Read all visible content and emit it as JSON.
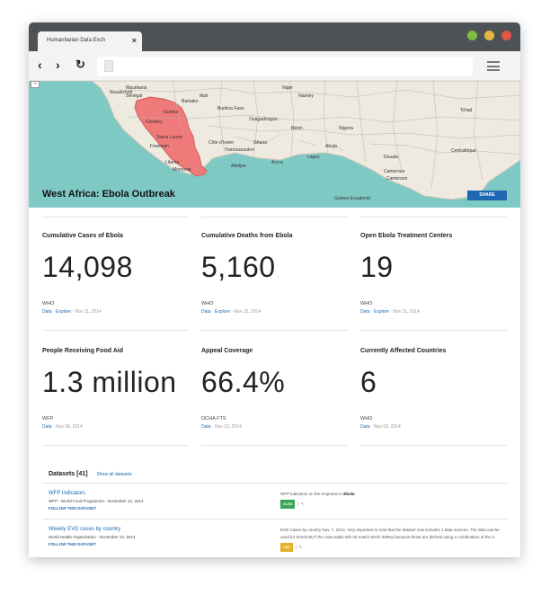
{
  "browser": {
    "tab_title": "Humanitarian Data Exch",
    "tab_close": "×",
    "back": "‹",
    "forward": "›",
    "reload": "↻"
  },
  "map": {
    "zoom_out": "−",
    "title": "West Africa: Ebola Outbreak",
    "share_label": "SHARE",
    "land_color": "#eeeae0",
    "sea_color": "#7fc9c4",
    "affected_color": "#f07a7a",
    "place_labels": [
      "Mauritania",
      "Sénégal",
      "Mali",
      "Niger",
      "Guinea",
      "Burkina Faso",
      "Bénin",
      "Nigeria",
      "Sierra Leone",
      "Côte d'Ivoire",
      "Ghana",
      "Liberia",
      "Yamoussoukro",
      "Abuja",
      "Lagos",
      "Accra",
      "Cameroun",
      "Cameroon",
      "Guinea Ecuatorial",
      "Conakry",
      "Freetown",
      "Monrovia",
      "Bamako",
      "Niamey",
      "Nouakchott",
      "Abidjan",
      "Douala",
      "Ouagadougou",
      "Tchad",
      "Centrafrique"
    ]
  },
  "stats": [
    {
      "title": "Cumulative Cases of Ebola",
      "value": "14,098",
      "source": "WHO",
      "links": [
        "Data",
        "Explore"
      ],
      "date": "Nov 11, 2014"
    },
    {
      "title": "Cumulative Deaths from Ebola",
      "value": "5,160",
      "source": "WHO",
      "links": [
        "Data",
        "Explore"
      ],
      "date": "Nov 12, 2014"
    },
    {
      "title": "Open Ebola Treatment Centers",
      "value": "19",
      "source": "WHO",
      "links": [
        "Data",
        "Explore"
      ],
      "date": "Nov 11, 2014"
    },
    {
      "title": "People Receiving Food Aid",
      "value": "1.3 million",
      "source": "WFP",
      "links": [
        "Data"
      ],
      "date": "Nov 08, 2014"
    },
    {
      "title": "Appeal Coverage",
      "value": "66.4%",
      "source": "OCHA FTS",
      "links": [
        "Data"
      ],
      "date": "Nov 10, 2014"
    },
    {
      "title": "Currently Affected Countries",
      "value": "6",
      "source": "WHO",
      "links": [
        "Data"
      ],
      "date": "Nov 09, 2014"
    }
  ],
  "datasets": {
    "heading": "Datasets",
    "count": "[41]",
    "show_all": "Show all datasets",
    "items": [
      {
        "title": "WFP Indicators",
        "org": "WFP - World Food Programme - November 13, 2014",
        "follow": "FOLLOW THIS DATASET",
        "desc_prefix": "WFP indicators on the response to",
        "desc_bold": "Ebola",
        "format": "XLSX",
        "format_color": "green"
      },
      {
        "title": "Weekly EVD cases by country",
        "org": "World Health Organization - November 13, 2014",
        "follow": "FOLLOW THIS DATASET",
        "desc_prefix": "EVD Cases by country Nov. 7, 2014. Very important to note that the dataset now includes 1 data sources. The data can be used for trends BUT the case totals will not match WHO SitRep because those are derived using a combination of the 2.",
        "desc_bold": "",
        "format": "CSV",
        "format_color": "yellow"
      }
    ]
  }
}
